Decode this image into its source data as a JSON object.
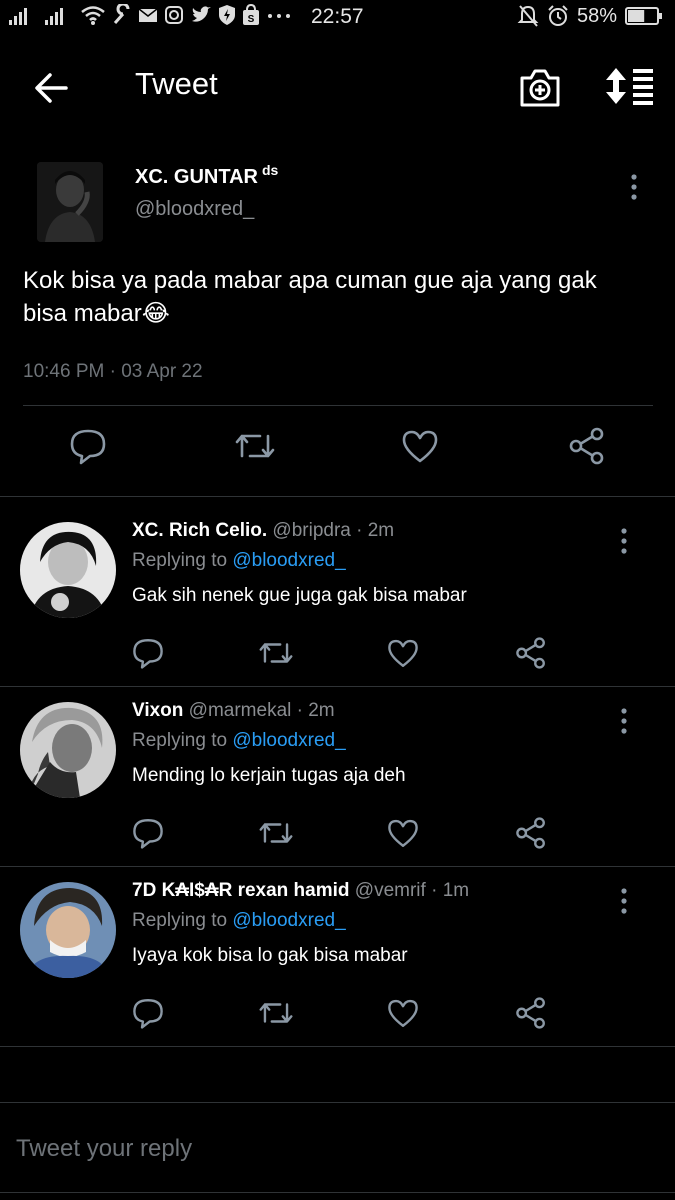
{
  "status_bar": {
    "time": "22:57",
    "battery_percent": "58%",
    "icons": [
      "signal-icon",
      "signal-icon",
      "wifi-icon",
      "wrench-icon",
      "mail-icon",
      "instagram-icon",
      "twitter-icon",
      "shield-icon",
      "shopping-icon",
      "more-dots-icon",
      "mute-icon",
      "alarm-icon",
      "battery-icon"
    ],
    "battery_level": 0.58
  },
  "header": {
    "title": "Tweet"
  },
  "main_tweet": {
    "display_name": "XC. GUNTAR",
    "name_badge": "ds",
    "handle": "@bloodxred_",
    "text": "Kok bisa ya pada mabar apa cuman gue aja yang gak bisa mabar😂",
    "timestamp": "10:46 PM · 03 Apr 22"
  },
  "replies": [
    {
      "display_name": "XC. Rich Celio.",
      "meta": " @bripdra · 2m",
      "replying_prefix": "Replying to ",
      "replying_to": "@bloodxred_",
      "text": "Gak sih nenek gue juga gak bisa mabar"
    },
    {
      "display_name": "Vixon",
      "meta": " @marmekal · 2m",
      "replying_prefix": "Replying to ",
      "replying_to": "@bloodxred_",
      "text": "Mending lo kerjain tugas aja deh"
    },
    {
      "display_name": "7D K₳I$₳R rexan hamid",
      "meta": " @vemrif · 1m",
      "replying_prefix": "Replying to ",
      "replying_to": "@bloodxred_",
      "text": "Iyaya kok bisa lo gak bisa mabar"
    }
  ],
  "composer": {
    "placeholder": "Tweet your reply"
  },
  "colors": {
    "background": "#000000",
    "text_primary": "#ffffff",
    "text_secondary": "#8a8d91",
    "mention": "#2a9df4",
    "icon": "#8b98a5",
    "divider": "#2f3336"
  }
}
